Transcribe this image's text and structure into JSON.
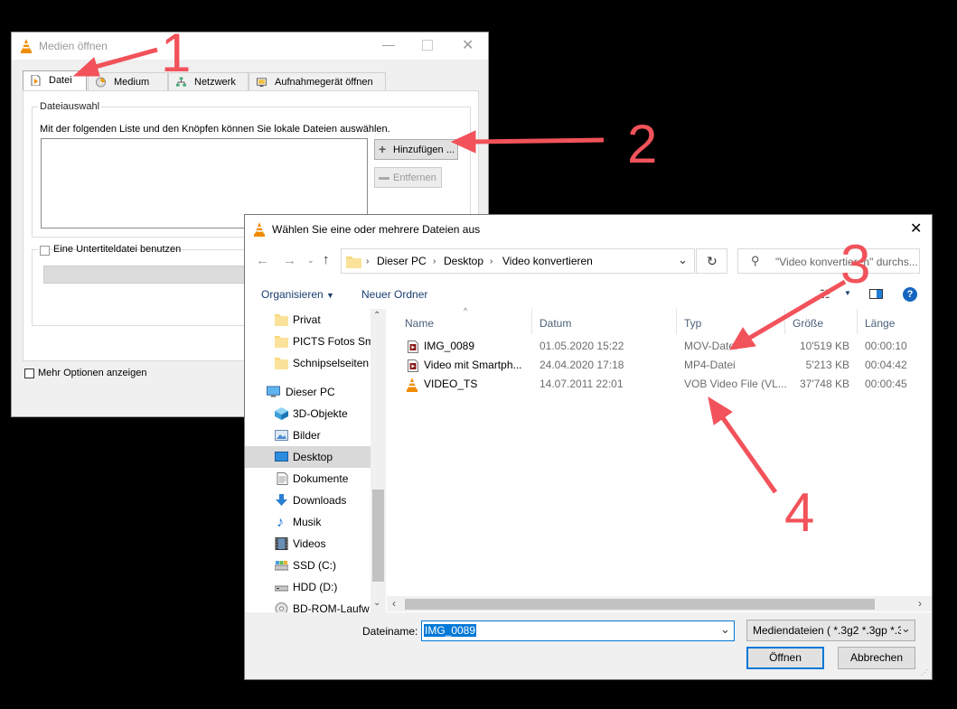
{
  "vlc_dialog": {
    "title": "Medien öffnen",
    "tabs": [
      "Datei",
      "Medium",
      "Netzwerk",
      "Aufnahmegerät öffnen"
    ],
    "group_label": "Dateiauswahl",
    "description": "Mit der folgenden Liste und den Knöpfen können Sie lokale Dateien auswählen.",
    "add_button": "Hinzufügen ...",
    "remove_button": "Entfernen",
    "subtitle_checkbox": "Eine Untertiteldatei benutzen",
    "more_options_checkbox": "Mehr Optionen anzeigen"
  },
  "file_dialog": {
    "title": "Wählen Sie eine oder mehrere Dateien aus",
    "breadcrumb": [
      "Dieser PC",
      "Desktop",
      "Video konvertieren"
    ],
    "search_placeholder": "\"Video konvertieren\" durchs...",
    "toolbar": {
      "organize": "Organisieren",
      "new_folder": "Neuer Ordner"
    },
    "nav_items": [
      {
        "label": "Privat",
        "icon": "folder-icon"
      },
      {
        "label": "PICTS Fotos Sma",
        "icon": "folder-icon"
      },
      {
        "label": "Schnipselseiten",
        "icon": "folder-icon"
      },
      {
        "label": "Dieser PC",
        "icon": "computer-icon"
      },
      {
        "label": "3D-Objekte",
        "icon": "3d-objects-icon"
      },
      {
        "label": "Bilder",
        "icon": "pictures-icon"
      },
      {
        "label": "Desktop",
        "icon": "desktop-icon",
        "selected": true
      },
      {
        "label": "Dokumente",
        "icon": "documents-icon"
      },
      {
        "label": "Downloads",
        "icon": "downloads-icon"
      },
      {
        "label": "Musik",
        "icon": "music-icon"
      },
      {
        "label": "Videos",
        "icon": "videos-icon"
      },
      {
        "label": "SSD (C:)",
        "icon": "drive-icon"
      },
      {
        "label": "HDD (D:)",
        "icon": "drive-icon"
      },
      {
        "label": "BD-ROM-Laufw",
        "icon": "disc-icon"
      }
    ],
    "columns": [
      "Name",
      "Datum",
      "Typ",
      "Größe",
      "Länge"
    ],
    "files": [
      {
        "name": "IMG_0089",
        "date": "01.05.2020 15:22",
        "type": "MOV-Datei",
        "size": "10'519 KB",
        "length": "00:00:10",
        "icon": "video-file-icon"
      },
      {
        "name": "Video mit Smartph...",
        "date": "24.04.2020 17:18",
        "type": "MP4-Datei",
        "size": "5'213 KB",
        "length": "00:04:42",
        "icon": "video-file-icon"
      },
      {
        "name": "VIDEO_TS",
        "date": "14.07.2011 22:01",
        "type": "VOB Video File (VL...",
        "size": "37'748 KB",
        "length": "00:00:45",
        "icon": "vlc-cone-icon"
      }
    ],
    "filename_label": "Dateiname:",
    "filename_value": "IMG_0089",
    "filter": "Mediendateien ( *.3g2 *.3gp *.3",
    "open_button": "Öffnen",
    "cancel_button": "Abbrechen"
  },
  "annotations": [
    "1",
    "2",
    "3",
    "4"
  ],
  "colors": {
    "annotation": "#f2525a",
    "selection": "#0078d7",
    "vlc_orange": "#f08c00"
  }
}
